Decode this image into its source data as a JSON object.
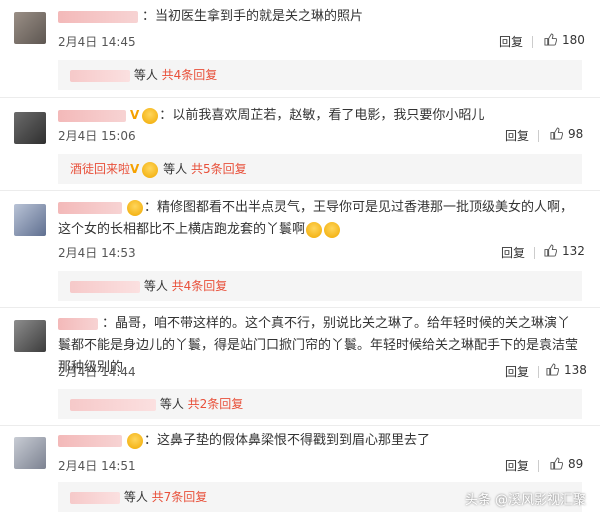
{
  "comments": [
    {
      "text": "当初医生拿到手的就是关之琳的照片",
      "date": "2月4日 14:45",
      "reply_label": "回复",
      "likes": "180",
      "sub": {
        "prefix": "",
        "suffix": "等人",
        "count_label": "共4条回复"
      }
    },
    {
      "text": "以前我喜欢周芷若，赵敏，看了电影，我只要你小昭儿",
      "date": "2月4日 15:06",
      "reply_label": "回复",
      "likes": "98",
      "sub": {
        "prefix": "酒徒回来啦",
        "suffix": "等人",
        "count_label": "共5条回复"
      }
    },
    {
      "text": "精修图都看不出半点灵气，王导你可是见过香港那一批顶级美女的人啊，这个女的长相都比不上横店跑龙套的丫鬟啊",
      "date": "2月4日 14:53",
      "reply_label": "回复",
      "likes": "132",
      "sub": {
        "prefix": "",
        "suffix": "等人",
        "count_label": "共4条回复"
      }
    },
    {
      "text": "晶哥，咱不带这样的。这个真不行，别说比关之琳了。给年轻时候的关之琳演丫鬟都不能是身边儿的丫鬟，得是站门口掀门帘的丫鬟。年轻时候给关之琳配手下的是袁洁莹那种级别的",
      "date": "2月4日 14:44",
      "reply_label": "回复",
      "likes": "138",
      "sub": {
        "prefix": "",
        "suffix": "等人",
        "count_label": "共2条回复"
      }
    },
    {
      "text": "这鼻子垫的假体鼻梁恨不得戳到到眉心那里去了",
      "date": "2月4日 14:51",
      "reply_label": "回复",
      "likes": "89",
      "sub": {
        "prefix": "",
        "suffix": "等人",
        "count_label": "共7条回复"
      }
    }
  ],
  "watermark": "头条 @溪风影视汇聚",
  "icons": {
    "like": "thumbs-up-icon",
    "badge": "vip-badge-icon",
    "emoji": "cry-emoji-icon"
  },
  "colors": {
    "accent": "#e8503a",
    "text": "#333333",
    "subbox": "#f5f5f5"
  }
}
